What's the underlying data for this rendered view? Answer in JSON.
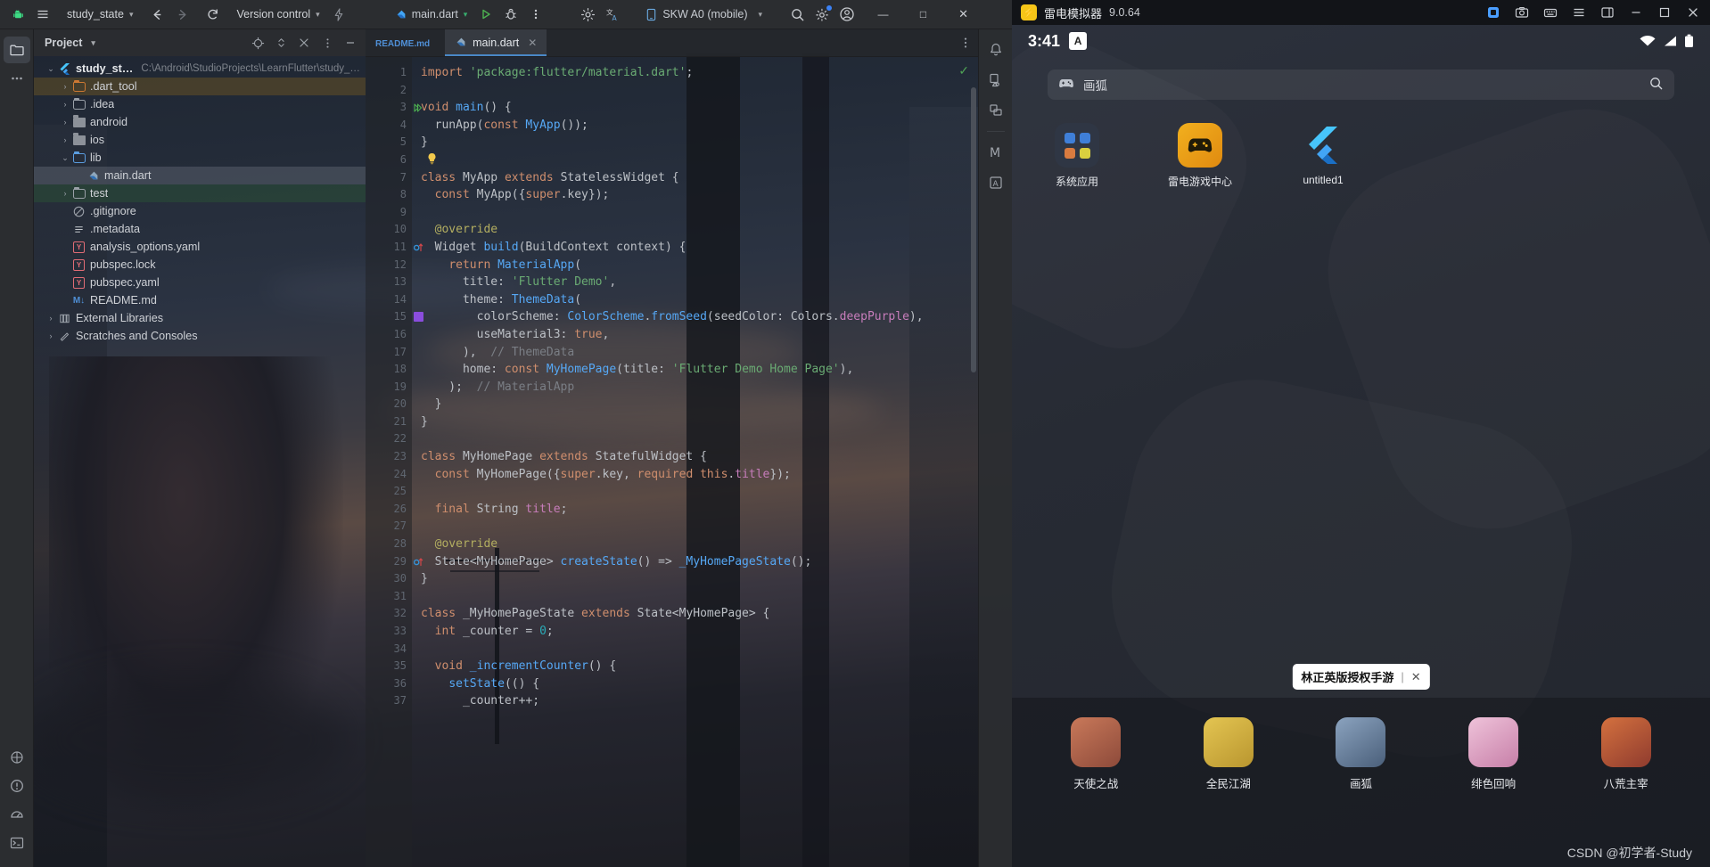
{
  "ide": {
    "titlebar": {
      "logo_icon": "android-logo-icon",
      "menu_icon": "hamburger-menu-icon",
      "project_name": "study_state",
      "back_icon": "arrow-left-icon",
      "forward_icon": "arrow-right-icon",
      "sync_icon": "refresh-sync-icon",
      "version_control": "Version control",
      "flash_icon": "lightning-icon",
      "run_config": "main.dart",
      "run_icon": "run-play-icon",
      "debug_icon": "debug-bug-icon",
      "more_icon": "more-vertical-icon",
      "settings_icon": "settings-gear-icon",
      "translate_icon": "translate-icon",
      "device": "SKW A0 (mobile)",
      "device_icon": "phone-device-icon",
      "search_icon": "search-icon",
      "gear_icon": "gear-icon",
      "account_icon": "account-avatar-icon",
      "minimize": "—",
      "maximize": "□",
      "close": "✕"
    },
    "project_panel": {
      "title": "Project",
      "icons": [
        "locate-icon",
        "expand-collapse-icon",
        "collapse-all-icon",
        "options-icon",
        "minimize-icon"
      ],
      "tree": [
        {
          "label": "study_state",
          "path": "C:\\Android\\StudioProjects\\LearnFlutter\\study_state",
          "icon": "flutter-icon",
          "arrow": "⌄",
          "indent": 0,
          "bold": true,
          "state": ""
        },
        {
          "label": ".dart_tool",
          "path": "",
          "icon": "folder-orange",
          "arrow": "›",
          "indent": 1,
          "bold": false,
          "state": "amber"
        },
        {
          "label": ".idea",
          "path": "",
          "icon": "folder-gray-dot",
          "arrow": "›",
          "indent": 1,
          "bold": false,
          "state": ""
        },
        {
          "label": "android",
          "path": "",
          "icon": "folder-dark",
          "arrow": "›",
          "indent": 1,
          "bold": false,
          "state": ""
        },
        {
          "label": "ios",
          "path": "",
          "icon": "folder-dark",
          "arrow": "›",
          "indent": 1,
          "bold": false,
          "state": ""
        },
        {
          "label": "lib",
          "path": "",
          "icon": "folder-blue",
          "arrow": "⌄",
          "indent": 1,
          "bold": false,
          "state": ""
        },
        {
          "label": "main.dart",
          "path": "",
          "icon": "dart-file-icon",
          "arrow": "",
          "indent": 2,
          "bold": false,
          "state": "selected"
        },
        {
          "label": "test",
          "path": "",
          "icon": "folder-gray-dot",
          "arrow": "›",
          "indent": 1,
          "bold": false,
          "state": "green"
        },
        {
          "label": ".gitignore",
          "path": "",
          "icon": "gitignore-icon",
          "arrow": "",
          "indent": 1,
          "bold": false,
          "state": ""
        },
        {
          "label": ".metadata",
          "path": "",
          "icon": "metadata-lines-icon",
          "arrow": "",
          "indent": 1,
          "bold": false,
          "state": ""
        },
        {
          "label": "analysis_options.yaml",
          "path": "",
          "icon": "yaml-icon",
          "arrow": "",
          "indent": 1,
          "bold": false,
          "state": ""
        },
        {
          "label": "pubspec.lock",
          "path": "",
          "icon": "yaml-icon",
          "arrow": "",
          "indent": 1,
          "bold": false,
          "state": ""
        },
        {
          "label": "pubspec.yaml",
          "path": "",
          "icon": "yaml-icon",
          "arrow": "",
          "indent": 1,
          "bold": false,
          "state": ""
        },
        {
          "label": "README.md",
          "path": "",
          "icon": "markdown-icon",
          "arrow": "",
          "indent": 1,
          "bold": false,
          "state": ""
        },
        {
          "label": "External Libraries",
          "path": "",
          "icon": "library-icon",
          "arrow": "›",
          "indent": 0,
          "bold": false,
          "state": ""
        },
        {
          "label": "Scratches and Consoles",
          "path": "",
          "icon": "scratches-icon",
          "arrow": "›",
          "indent": 0,
          "bold": false,
          "state": ""
        }
      ]
    },
    "tabs": [
      {
        "label": "README.md",
        "icon": "markdown-icon",
        "active": false,
        "closable": false
      },
      {
        "label": "main.dart",
        "icon": "dart-file-icon",
        "active": true,
        "closable": true
      }
    ],
    "editor": {
      "first_line": 1,
      "last_line": 37,
      "inspection_status_icon": "green-check-icon",
      "gutter_marks": {
        "3": "run-gutter-icon",
        "6": "intention-bulb-icon",
        "11": "override-method-icon",
        "15": "color-swatch-deeppurple",
        "29": "override-method-icon"
      },
      "color_swatch": "#8a4ddd",
      "lines": [
        {
          "n": 1,
          "tokens": [
            [
              "k",
              "import"
            ],
            [
              "ty",
              " "
            ],
            [
              "s",
              "'package:flutter/material.dart'"
            ],
            [
              "ty",
              ";"
            ]
          ]
        },
        {
          "n": 2,
          "tokens": []
        },
        {
          "n": 3,
          "tokens": [
            [
              "k",
              "void "
            ],
            [
              "fn",
              "main"
            ],
            [
              "ty",
              "() {"
            ]
          ]
        },
        {
          "n": 4,
          "tokens": [
            [
              "ty",
              "  runApp("
            ],
            [
              "k",
              "const "
            ],
            [
              "fn",
              "MyApp"
            ],
            [
              "ty",
              "());"
            ]
          ]
        },
        {
          "n": 5,
          "tokens": [
            [
              "ty",
              "}"
            ]
          ]
        },
        {
          "n": 6,
          "tokens": []
        },
        {
          "n": 7,
          "tokens": [
            [
              "k",
              "class "
            ],
            [
              "ty",
              "MyApp "
            ],
            [
              "k",
              "extends "
            ],
            [
              "ty",
              "StatelessWidget {"
            ]
          ]
        },
        {
          "n": 8,
          "tokens": [
            [
              "ty",
              "  "
            ],
            [
              "k",
              "const "
            ],
            [
              "ty",
              "MyApp({"
            ],
            [
              "k",
              "super"
            ],
            [
              "ty",
              ".key});"
            ]
          ]
        },
        {
          "n": 9,
          "tokens": []
        },
        {
          "n": 10,
          "tokens": [
            [
              "ty",
              "  "
            ],
            [
              "an",
              "@override"
            ]
          ]
        },
        {
          "n": 11,
          "tokens": [
            [
              "ty",
              "  Widget "
            ],
            [
              "fn",
              "build"
            ],
            [
              "ty",
              "(BuildContext context) {"
            ]
          ]
        },
        {
          "n": 12,
          "tokens": [
            [
              "ty",
              "    "
            ],
            [
              "k",
              "return "
            ],
            [
              "fn",
              "MaterialApp"
            ],
            [
              "ty",
              "("
            ]
          ]
        },
        {
          "n": 13,
          "tokens": [
            [
              "ty",
              "      title: "
            ],
            [
              "s",
              "'Flutter Demo'"
            ],
            [
              "ty",
              ","
            ]
          ]
        },
        {
          "n": 14,
          "tokens": [
            [
              "ty",
              "      theme: "
            ],
            [
              "fn",
              "ThemeData"
            ],
            [
              "ty",
              "("
            ]
          ]
        },
        {
          "n": 15,
          "tokens": [
            [
              "ty",
              "        colorScheme: "
            ],
            [
              "fn",
              "ColorScheme"
            ],
            [
              "ty",
              "."
            ],
            [
              "fn",
              "fromSeed"
            ],
            [
              "ty",
              "(seedColor: Colors."
            ],
            [
              "pr",
              "deepPurple"
            ],
            [
              "ty",
              "),"
            ]
          ]
        },
        {
          "n": 16,
          "tokens": [
            [
              "ty",
              "        useMaterial3: "
            ],
            [
              "k",
              "true"
            ],
            [
              "ty",
              ","
            ]
          ]
        },
        {
          "n": 17,
          "tokens": [
            [
              "ty",
              "      ),  "
            ],
            [
              "cm",
              "// ThemeData"
            ]
          ]
        },
        {
          "n": 18,
          "tokens": [
            [
              "ty",
              "      home: "
            ],
            [
              "k",
              "const "
            ],
            [
              "fn",
              "MyHomePage"
            ],
            [
              "ty",
              "(title: "
            ],
            [
              "s",
              "'Flutter Demo Home Page'"
            ],
            [
              "ty",
              "),"
            ]
          ]
        },
        {
          "n": 19,
          "tokens": [
            [
              "ty",
              "    );  "
            ],
            [
              "cm",
              "// MaterialApp"
            ]
          ]
        },
        {
          "n": 20,
          "tokens": [
            [
              "ty",
              "  }"
            ]
          ]
        },
        {
          "n": 21,
          "tokens": [
            [
              "ty",
              "}"
            ]
          ]
        },
        {
          "n": 22,
          "tokens": []
        },
        {
          "n": 23,
          "tokens": [
            [
              "k",
              "class "
            ],
            [
              "ty",
              "MyHomePage "
            ],
            [
              "k",
              "extends "
            ],
            [
              "ty",
              "StatefulWidget {"
            ]
          ]
        },
        {
          "n": 24,
          "tokens": [
            [
              "ty",
              "  "
            ],
            [
              "k",
              "const "
            ],
            [
              "ty",
              "MyHomePage({"
            ],
            [
              "k",
              "super"
            ],
            [
              "ty",
              ".key, "
            ],
            [
              "k",
              "required "
            ],
            [
              "k",
              "this"
            ],
            [
              "ty",
              "."
            ],
            [
              "pr",
              "title"
            ],
            [
              "ty",
              "});"
            ]
          ]
        },
        {
          "n": 25,
          "tokens": []
        },
        {
          "n": 26,
          "tokens": [
            [
              "ty",
              "  "
            ],
            [
              "k",
              "final "
            ],
            [
              "ty",
              "String "
            ],
            [
              "pr",
              "title"
            ],
            [
              "ty",
              ";"
            ]
          ]
        },
        {
          "n": 27,
          "tokens": []
        },
        {
          "n": 28,
          "tokens": [
            [
              "ty",
              "  "
            ],
            [
              "an",
              "@override"
            ]
          ]
        },
        {
          "n": 29,
          "tokens": [
            [
              "ty",
              "  State<MyHomePage> "
            ],
            [
              "fn",
              "createState"
            ],
            [
              "ty",
              "() => "
            ],
            [
              "fn",
              "_MyHomePageState"
            ],
            [
              "ty",
              "();"
            ]
          ]
        },
        {
          "n": 30,
          "tokens": [
            [
              "ty",
              "}"
            ]
          ]
        },
        {
          "n": 31,
          "tokens": []
        },
        {
          "n": 32,
          "tokens": [
            [
              "k",
              "class "
            ],
            [
              "ty",
              "_MyHomePageState "
            ],
            [
              "k",
              "extends "
            ],
            [
              "ty",
              "State<MyHomePage> {"
            ]
          ]
        },
        {
          "n": 33,
          "tokens": [
            [
              "ty",
              "  "
            ],
            [
              "k",
              "int "
            ],
            [
              "ty",
              "_counter = "
            ],
            [
              "num",
              "0"
            ],
            [
              "ty",
              ";"
            ]
          ]
        },
        {
          "n": 34,
          "tokens": []
        },
        {
          "n": 35,
          "tokens": [
            [
              "ty",
              "  "
            ],
            [
              "k",
              "void "
            ],
            [
              "fn",
              "_incrementCounter"
            ],
            [
              "ty",
              "() {"
            ]
          ]
        },
        {
          "n": 36,
          "tokens": [
            [
              "ty",
              "    "
            ],
            [
              "fn",
              "setState"
            ],
            [
              "ty",
              "(() {"
            ]
          ]
        },
        {
          "n": 37,
          "tokens": [
            [
              "ty",
              "      _counter++;"
            ]
          ]
        }
      ]
    },
    "right_stripe_icons": [
      "notifications-bell-icon",
      "device-manager-icon",
      "resource-manager-icon",
      "gemini-icon",
      "translate-panel-icon"
    ],
    "left_stripe_icons": [
      "project-folder-icon",
      "more-tools-icon",
      "structure-icon",
      "problems-icon",
      "profiler-icon",
      "terminal-icon"
    ]
  },
  "emulator": {
    "title": "雷电模拟器",
    "version": "9.0.64",
    "logo_icon": "ldplayer-logo-icon",
    "toolbar_icons": [
      "multi-instance-icon",
      "screenshot-icon",
      "keyboard-mapping-icon",
      "menu-icon",
      "sidebar-icon",
      "minimize-icon",
      "maximize-icon",
      "close-icon"
    ],
    "status": {
      "time": "3:41",
      "ime_badge": "A",
      "wifi_icon": "wifi-icon",
      "signal_icon": "signal-icon",
      "battery_icon": "battery-icon"
    },
    "search": {
      "value": "画狐",
      "left_icon": "gamepad-icon",
      "right_icon": "search-icon"
    },
    "apps": [
      {
        "name": "系统应用",
        "icon": "system-apps-folder-icon"
      },
      {
        "name": "雷电游戏中心",
        "icon": "ld-game-center-icon"
      },
      {
        "name": "untitled1",
        "icon": "flutter-app-icon"
      }
    ],
    "promo": {
      "text": "林正英版授权手游",
      "sep": "|",
      "close": "✕"
    },
    "games": [
      {
        "name": "天使之战",
        "color1": "#8d4a3a",
        "color2": "#c9795a"
      },
      {
        "name": "全民江湖",
        "color1": "#b9962f",
        "color2": "#e4c552"
      },
      {
        "name": "画狐",
        "color1": "#4a5f7a",
        "color2": "#8ba3bf"
      },
      {
        "name": "绯色回响",
        "color1": "#c77fa8",
        "color2": "#efc3da"
      },
      {
        "name": "八荒主宰",
        "color1": "#8f3b2e",
        "color2": "#d4713f"
      }
    ],
    "watermark": "CSDN @初学者-Study"
  }
}
